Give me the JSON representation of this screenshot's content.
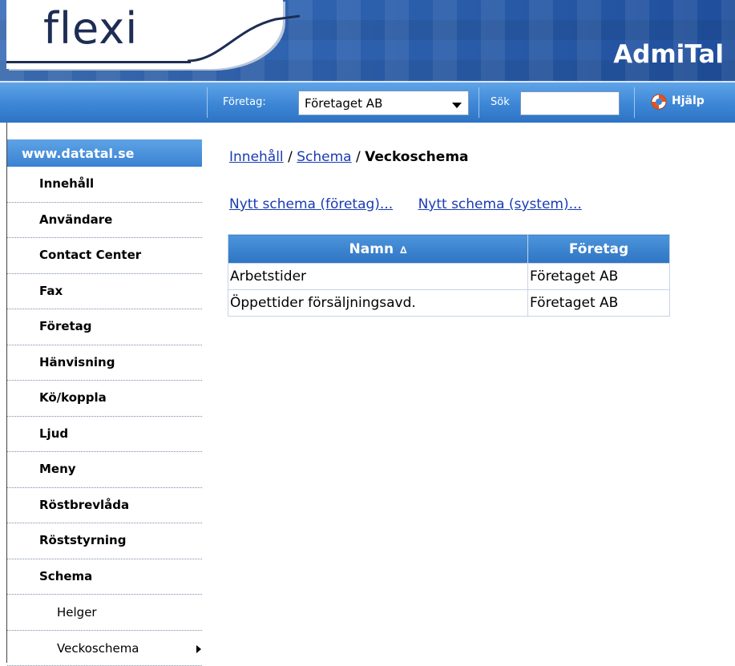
{
  "header": {
    "logo_text": "flexi",
    "app_title": "AdmiTal"
  },
  "toolbar": {
    "company_label": "Företag:",
    "company_value": "Företaget AB",
    "search_label": "Sök",
    "search_value": "",
    "help_label": "Hjälp"
  },
  "sidebar": {
    "site_label": "www.datatal.se",
    "items": [
      {
        "label": "Innehåll"
      },
      {
        "label": "Användare"
      },
      {
        "label": "Contact Center"
      },
      {
        "label": "Fax"
      },
      {
        "label": "Företag"
      },
      {
        "label": "Hänvisning"
      },
      {
        "label": "Kö/koppla"
      },
      {
        "label": "Ljud"
      },
      {
        "label": "Meny"
      },
      {
        "label": "Röstbrevlåda"
      },
      {
        "label": "Röststyrning"
      },
      {
        "label": "Schema"
      },
      {
        "label": "Helger"
      },
      {
        "label": "Veckoschema"
      }
    ]
  },
  "breadcrumb": {
    "root": "Innehåll",
    "sep": " / ",
    "parent": "Schema",
    "current": "Veckoschema"
  },
  "actions": {
    "new_company": "Nytt schema (företag)...",
    "new_system": "Nytt schema (system)..."
  },
  "table": {
    "columns": [
      "Namn",
      "Företag"
    ],
    "sort_indicator": "∆",
    "rows": [
      [
        "Arbetstider",
        "Företaget AB"
      ],
      [
        "Öppettider försäljningsavd.",
        "Företaget AB"
      ]
    ]
  },
  "colors": {
    "header_blue": "#2f63b0",
    "toolbar_blue": "#3d86d6",
    "link": "#1a3bb3"
  }
}
